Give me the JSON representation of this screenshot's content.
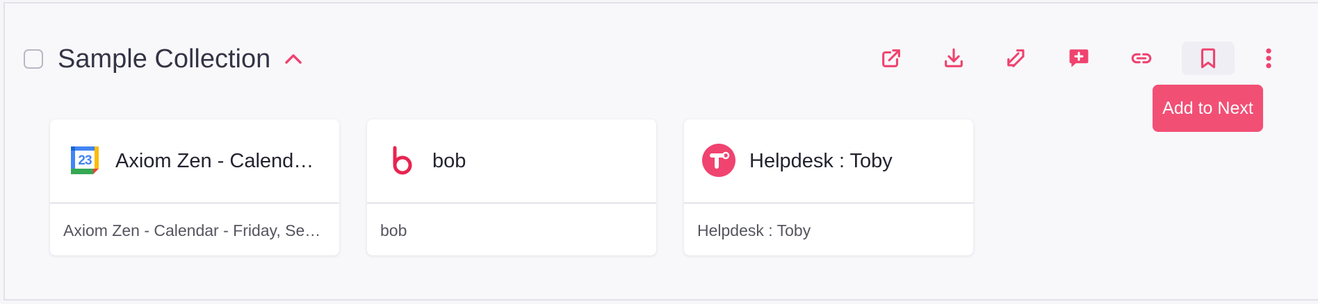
{
  "collection": {
    "title": "Sample Collection",
    "toolbar": [
      {
        "name": "open-all",
        "icon": "open-external-icon"
      },
      {
        "name": "download",
        "icon": "download-icon"
      },
      {
        "name": "move",
        "icon": "move-icon"
      },
      {
        "name": "add-note",
        "icon": "comment-add-icon"
      },
      {
        "name": "copy-link",
        "icon": "link-icon"
      },
      {
        "name": "add-to-next",
        "icon": "bookmark-icon"
      },
      {
        "name": "more",
        "icon": "more-vertical-icon"
      }
    ],
    "tooltip": "Add to Next",
    "cards": [
      {
        "name": "Axiom Zen - Calendar - Friday, September",
        "description": "Axiom Zen - Calendar - Friday, September",
        "icon": "google-calendar-icon",
        "icon_text": "23"
      },
      {
        "name": "bob",
        "description": "bob",
        "icon": "bob-logo-icon"
      },
      {
        "name": "Helpdesk : Toby",
        "description": "Helpdesk : Toby",
        "icon": "toby-logo-icon"
      }
    ]
  },
  "colors": {
    "accent": "#f0436f",
    "tooltip_bg": "#f24f75",
    "title": "#343445"
  }
}
